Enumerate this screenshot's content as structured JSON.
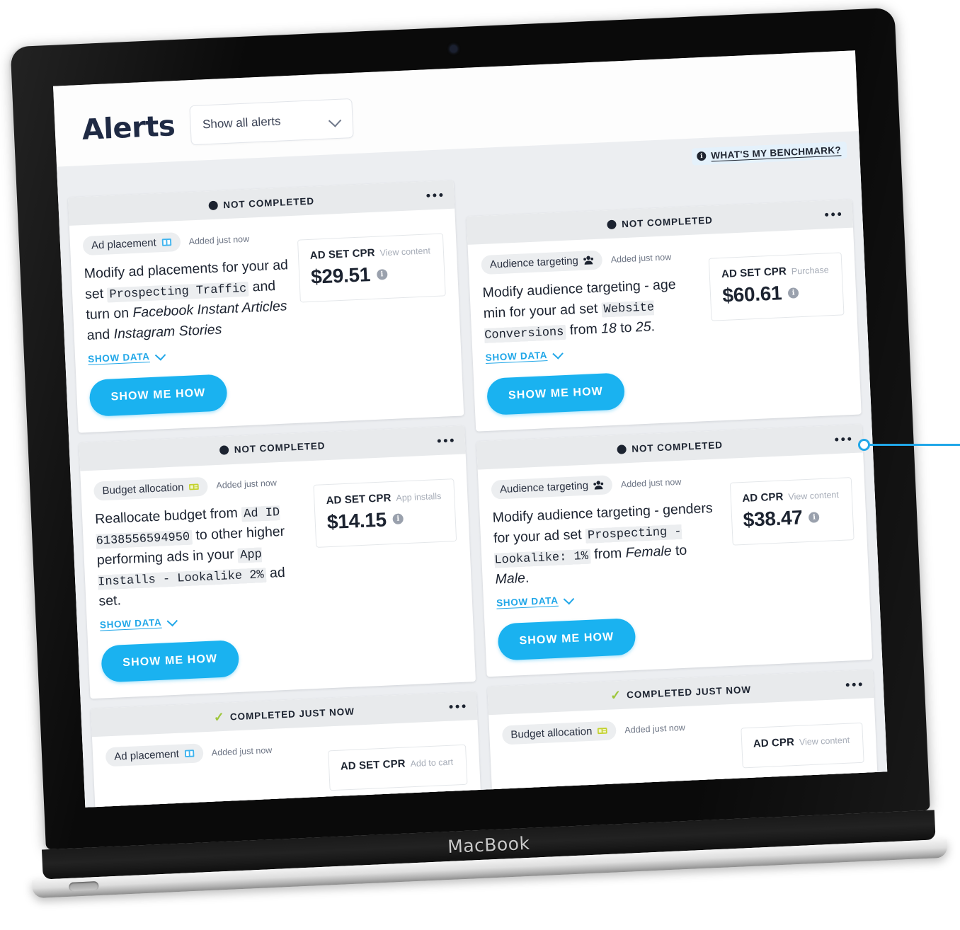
{
  "device": {
    "brand_label": "MacBook"
  },
  "header": {
    "title": "Alerts",
    "filter": {
      "value": "Show all alerts",
      "chevron_icon": "chevron-down-icon"
    }
  },
  "benchmark": {
    "info_icon_glyph": "i",
    "label": "WHAT'S MY BENCHMARK?"
  },
  "status_labels": {
    "not_completed": "NOT COMPLETED",
    "completed_just_now": "COMPLETED JUST NOW"
  },
  "common": {
    "added_just_now": "Added just now",
    "show_data": "SHOW DATA",
    "show_me_how": "SHOW ME HOW",
    "menu_icon": "overflow-menu-icon",
    "info_glyph": "i"
  },
  "colors": {
    "accent_blue": "#1ab2f0",
    "link_blue": "#21a7e8",
    "dark_navy": "#1c2330",
    "completed_green": "#9ec63b",
    "status_bar_grey": "#e8eaec",
    "board_grey": "#eceef1"
  },
  "cards": [
    {
      "status": "NOT COMPLETED",
      "status_type": "not-completed",
      "tag": "Ad placement",
      "tag_icon": "ad-placement-icon",
      "added": "Added just now",
      "text_parts": [
        {
          "t": "Modify ad placements for your ad set ",
          "style": "plain"
        },
        {
          "t": "Prospecting Traffic",
          "style": "mono"
        },
        {
          "t": " and turn on ",
          "style": "plain"
        },
        {
          "t": "Facebook Instant Articles",
          "style": "ital"
        },
        {
          "t": " and ",
          "style": "plain"
        },
        {
          "t": "Instagram Stories",
          "style": "ital"
        }
      ],
      "metric": {
        "name": "AD SET CPR",
        "sub": "View content",
        "value": "$29.51"
      }
    },
    {
      "status": "NOT COMPLETED",
      "status_type": "not-completed",
      "tag": "Audience targeting",
      "tag_icon": "audience-targeting-icon",
      "added": "Added just now",
      "text_parts": [
        {
          "t": "Modify audience targeting - age min for your ad set ",
          "style": "plain"
        },
        {
          "t": "Website Conversions",
          "style": "mono"
        },
        {
          "t": " from ",
          "style": "plain"
        },
        {
          "t": "18",
          "style": "ital"
        },
        {
          "t": " to ",
          "style": "plain"
        },
        {
          "t": "25",
          "style": "ital"
        },
        {
          "t": ".",
          "style": "plain"
        }
      ],
      "metric": {
        "name": "AD SET CPR",
        "sub": "Purchase",
        "value": "$60.61"
      }
    },
    {
      "status": "NOT COMPLETED",
      "status_type": "not-completed",
      "tag": "Budget allocation",
      "tag_icon": "budget-allocation-icon",
      "added": "Added just now",
      "text_parts": [
        {
          "t": "Reallocate budget from ",
          "style": "plain"
        },
        {
          "t": "Ad ID 6138556594950",
          "style": "mono"
        },
        {
          "t": " to other higher performing ads in your ",
          "style": "plain"
        },
        {
          "t": "App Installs - Lookalike 2%",
          "style": "mono"
        },
        {
          "t": " ad set.",
          "style": "plain"
        }
      ],
      "metric": {
        "name": "AD SET CPR",
        "sub": "App installs",
        "value": "$14.15"
      }
    },
    {
      "status": "NOT COMPLETED",
      "status_type": "not-completed",
      "tag": "Audience targeting",
      "tag_icon": "audience-targeting-icon",
      "added": "Added just now",
      "text_parts": [
        {
          "t": "Modify audience targeting - genders for your ad set ",
          "style": "plain"
        },
        {
          "t": "Prospecting - Lookalike: 1%",
          "style": "mono"
        },
        {
          "t": " from ",
          "style": "plain"
        },
        {
          "t": "Female",
          "style": "ital"
        },
        {
          "t": " to ",
          "style": "plain"
        },
        {
          "t": "Male",
          "style": "ital"
        },
        {
          "t": ".",
          "style": "plain"
        }
      ],
      "metric": {
        "name": "AD CPR",
        "sub": "View content",
        "value": "$38.47"
      }
    },
    {
      "status": "COMPLETED JUST NOW",
      "status_type": "completed",
      "tag": "Ad placement",
      "tag_icon": "ad-placement-icon",
      "added": "Added just now",
      "text_parts": [],
      "metric": {
        "name": "AD SET CPR",
        "sub": "Add to cart",
        "value": ""
      }
    },
    {
      "status": "COMPLETED JUST NOW",
      "status_type": "completed",
      "tag": "Budget allocation",
      "tag_icon": "budget-allocation-icon",
      "added": "Added just now",
      "text_parts": [],
      "metric": {
        "name": "AD CPR",
        "sub": "View content",
        "value": ""
      }
    }
  ],
  "annotation": {
    "marker_icon": "callout-ring-marker"
  }
}
